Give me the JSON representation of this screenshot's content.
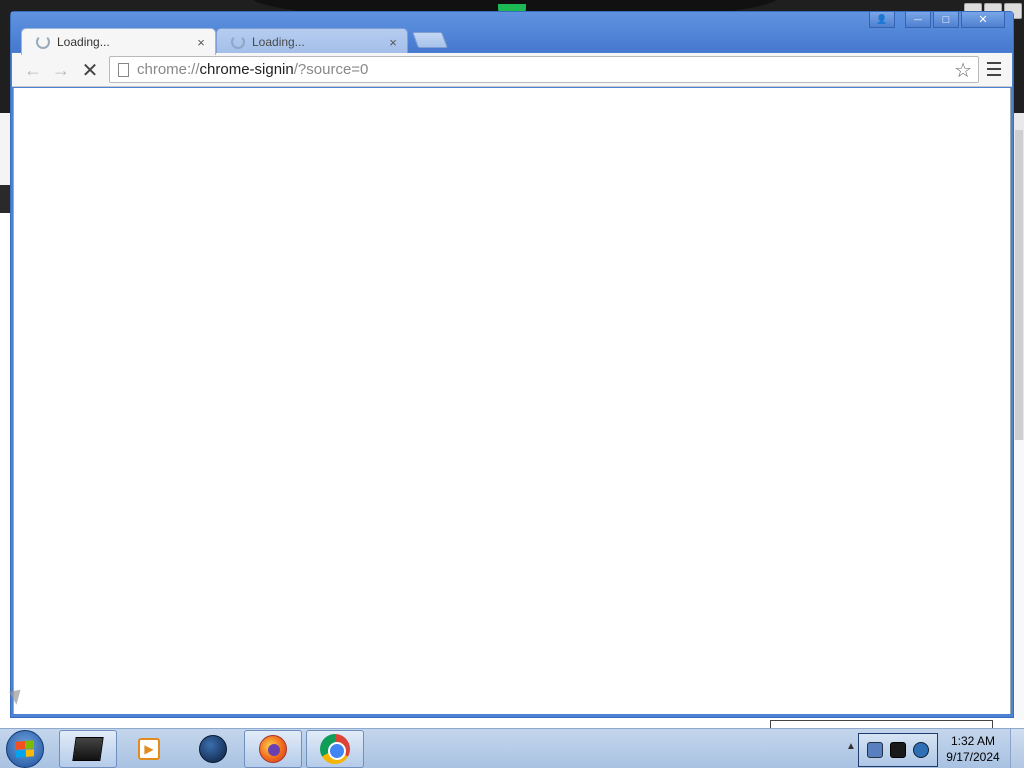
{
  "browser": {
    "tabs": [
      {
        "title": "Loading...",
        "active": true,
        "close_label": "×"
      },
      {
        "title": "Loading...",
        "active": false,
        "close_label": "×"
      }
    ],
    "address_bar": {
      "scheme": "chrome://",
      "host": "chrome-signin",
      "tail": "/?source=0"
    },
    "nav": {
      "back": "←",
      "forward": "→",
      "stop": "✕"
    },
    "star_icon": "☆",
    "window_controls": {
      "profile": "👤",
      "minimize": "—",
      "maximize": "□",
      "close": "✕"
    }
  },
  "taskbar": {
    "apps": [
      {
        "name": "monitor-app",
        "active": true
      },
      {
        "name": "media-player",
        "active": false
      },
      {
        "name": "globe-app",
        "active": false
      },
      {
        "name": "firefox",
        "active": true
      },
      {
        "name": "chrome",
        "active": true
      }
    ],
    "tray_arrow": "▲",
    "clock": {
      "time": "1:32 AM",
      "date": "9/17/2024"
    }
  },
  "colors": {
    "chrome_frame": "#4b82d4",
    "taskbar": "#b8cce8"
  }
}
